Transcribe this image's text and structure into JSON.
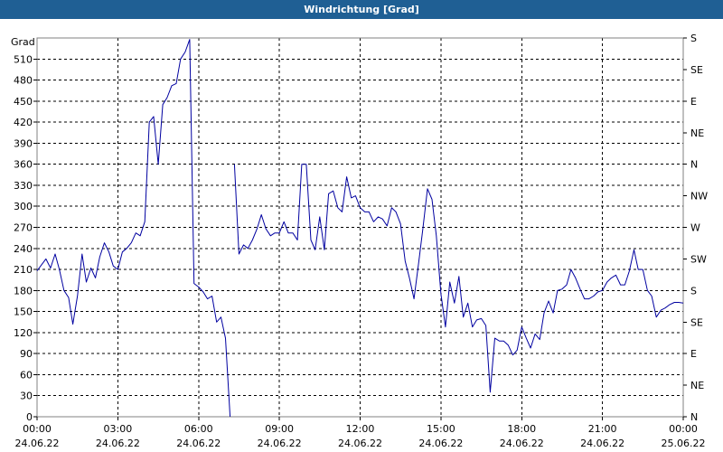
{
  "window": {
    "title": "Windrichtung [Grad]"
  },
  "colors": {
    "titlebar": "#1f5f94",
    "line": "#0000a0",
    "grid": "#000000",
    "frame": "#808080"
  },
  "chart_data": {
    "type": "line",
    "title": "Windrichtung [Grad]",
    "ylabel": "Grad",
    "ylim": [
      0,
      540
    ],
    "yticks": [
      0,
      30,
      60,
      90,
      120,
      150,
      180,
      210,
      240,
      270,
      300,
      330,
      360,
      390,
      420,
      450,
      480,
      510
    ],
    "right_ticks": [
      {
        "value": 0,
        "label": "N"
      },
      {
        "value": 45,
        "label": "NE"
      },
      {
        "value": 90,
        "label": "E"
      },
      {
        "value": 135,
        "label": "SE"
      },
      {
        "value": 180,
        "label": "S"
      },
      {
        "value": 225,
        "label": "SW"
      },
      {
        "value": 270,
        "label": "W"
      },
      {
        "value": 315,
        "label": "NW"
      },
      {
        "value": 360,
        "label": "N"
      },
      {
        "value": 405,
        "label": "NE"
      },
      {
        "value": 450,
        "label": "E"
      },
      {
        "value": 495,
        "label": "SE"
      },
      {
        "value": 540,
        "label": "S"
      }
    ],
    "xlim": [
      0,
      24
    ],
    "xticks": [
      {
        "h": 0,
        "time": "00:00",
        "date": "24.06.22"
      },
      {
        "h": 3,
        "time": "03:00",
        "date": "24.06.22"
      },
      {
        "h": 6,
        "time": "06:00",
        "date": "24.06.22"
      },
      {
        "h": 9,
        "time": "09:00",
        "date": "24.06.22"
      },
      {
        "h": 12,
        "time": "12:00",
        "date": "24.06.22"
      },
      {
        "h": 15,
        "time": "15:00",
        "date": "24.06.22"
      },
      {
        "h": 18,
        "time": "18:00",
        "date": "24.06.22"
      },
      {
        "h": 21,
        "time": "21:00",
        "date": "24.06.22"
      },
      {
        "h": 24,
        "time": "00:00",
        "date": "25.06.22"
      }
    ],
    "grid": true,
    "series": [
      {
        "segments": [
          [
            [
              0.0,
              208
            ],
            [
              0.33,
              225
            ],
            [
              0.5,
              212
            ],
            [
              0.67,
              232
            ],
            [
              0.83,
              210
            ],
            [
              1.0,
              180
            ],
            [
              1.17,
              170
            ],
            [
              1.33,
              132
            ],
            [
              1.5,
              172
            ],
            [
              1.67,
              232
            ],
            [
              1.83,
              192
            ],
            [
              2.0,
              212
            ],
            [
              2.17,
              198
            ],
            [
              2.33,
              228
            ],
            [
              2.5,
              248
            ],
            [
              2.67,
              235
            ],
            [
              2.83,
              215
            ],
            [
              3.0,
              210
            ],
            [
              3.17,
              235
            ],
            [
              3.33,
              240
            ],
            [
              3.5,
              248
            ],
            [
              3.67,
              262
            ],
            [
              3.83,
              258
            ],
            [
              4.0,
              278
            ],
            [
              4.17,
              420
            ],
            [
              4.33,
              428
            ],
            [
              4.5,
              360
            ],
            [
              4.67,
              445
            ],
            [
              4.83,
              455
            ],
            [
              5.0,
              472
            ],
            [
              5.17,
              475
            ],
            [
              5.33,
              510
            ],
            [
              5.5,
              520
            ],
            [
              5.67,
              538
            ],
            [
              5.83,
              190
            ],
            [
              6.0,
              185
            ],
            [
              6.17,
              178
            ],
            [
              6.33,
              168
            ],
            [
              6.5,
              172
            ],
            [
              6.67,
              135
            ],
            [
              6.83,
              142
            ],
            [
              7.0,
              112
            ],
            [
              7.17,
              0
            ]
          ],
          [
            [
              7.33,
              360
            ],
            [
              7.5,
              232
            ],
            [
              7.67,
              245
            ],
            [
              7.83,
              240
            ],
            [
              8.0,
              252
            ],
            [
              8.17,
              268
            ],
            [
              8.33,
              288
            ],
            [
              8.5,
              268
            ],
            [
              8.67,
              258
            ],
            [
              8.83,
              262
            ],
            [
              9.0,
              262
            ],
            [
              9.17,
              278
            ],
            [
              9.33,
              262
            ],
            [
              9.5,
              262
            ],
            [
              9.67,
              252
            ],
            [
              9.83,
              360
            ],
            [
              10.0,
              360
            ],
            [
              10.17,
              252
            ],
            [
              10.33,
              238
            ],
            [
              10.5,
              285
            ],
            [
              10.67,
              238
            ],
            [
              10.83,
              318
            ],
            [
              11.0,
              322
            ],
            [
              11.17,
              298
            ],
            [
              11.33,
              292
            ],
            [
              11.5,
              342
            ],
            [
              11.67,
              312
            ],
            [
              11.83,
              315
            ],
            [
              12.0,
              298
            ],
            [
              12.17,
              292
            ],
            [
              12.33,
              292
            ],
            [
              12.5,
              278
            ],
            [
              12.67,
              285
            ],
            [
              12.83,
              282
            ],
            [
              13.0,
              272
            ],
            [
              13.17,
              298
            ],
            [
              13.33,
              292
            ],
            [
              13.5,
              275
            ],
            [
              13.67,
              222
            ],
            [
              13.83,
              198
            ],
            [
              14.0,
              168
            ],
            [
              14.17,
              218
            ],
            [
              14.33,
              268
            ],
            [
              14.5,
              325
            ],
            [
              14.67,
              310
            ],
            [
              14.83,
              258
            ],
            [
              15.0,
              175
            ],
            [
              15.17,
              128
            ],
            [
              15.33,
              192
            ],
            [
              15.5,
              162
            ],
            [
              15.67,
              200
            ],
            [
              15.83,
              142
            ],
            [
              16.0,
              162
            ],
            [
              16.17,
              128
            ],
            [
              16.33,
              138
            ],
            [
              16.5,
              140
            ],
            [
              16.67,
              130
            ],
            [
              16.83,
              35
            ],
            [
              17.0,
              112
            ],
            [
              17.17,
              108
            ],
            [
              17.33,
              108
            ],
            [
              17.5,
              102
            ],
            [
              17.67,
              88
            ],
            [
              17.83,
              95
            ],
            [
              18.0,
              128
            ],
            [
              18.17,
              112
            ],
            [
              18.33,
              98
            ],
            [
              18.5,
              118
            ],
            [
              18.67,
              110
            ],
            [
              18.83,
              148
            ],
            [
              19.0,
              165
            ],
            [
              19.17,
              148
            ],
            [
              19.33,
              180
            ],
            [
              19.5,
              182
            ],
            [
              19.67,
              188
            ],
            [
              19.83,
              210
            ],
            [
              20.0,
              198
            ],
            [
              20.17,
              182
            ],
            [
              20.33,
              168
            ],
            [
              20.5,
              168
            ],
            [
              20.67,
              172
            ],
            [
              20.83,
              178
            ],
            [
              21.0,
              180
            ],
            [
              21.17,
              192
            ],
            [
              21.33,
              198
            ],
            [
              21.5,
              202
            ],
            [
              21.67,
              188
            ],
            [
              21.83,
              188
            ],
            [
              22.0,
              208
            ],
            [
              22.17,
              238
            ],
            [
              22.33,
              210
            ],
            [
              22.5,
              210
            ],
            [
              22.67,
              180
            ],
            [
              22.83,
              172
            ],
            [
              23.0,
              142
            ],
            [
              23.17,
              152
            ],
            [
              23.33,
              155
            ],
            [
              23.5,
              160
            ],
            [
              23.67,
              163
            ],
            [
              23.83,
              163
            ],
            [
              24.0,
              162
            ]
          ]
        ]
      }
    ]
  }
}
